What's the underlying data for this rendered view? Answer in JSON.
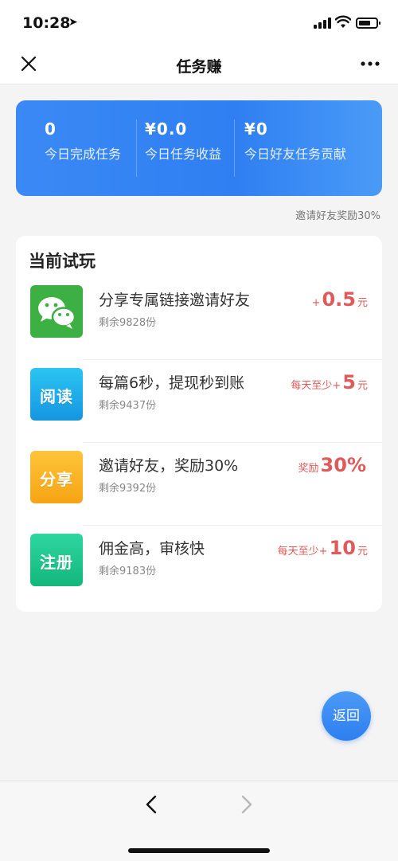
{
  "status": {
    "time": "10:28"
  },
  "nav": {
    "title": "任务赚"
  },
  "stats": [
    {
      "value": "0",
      "label": "今日完成任务"
    },
    {
      "value": "¥0.0",
      "label": "今日任务收益"
    },
    {
      "value": "¥0",
      "label": "今日好友任务贡献"
    }
  ],
  "invite_note": "邀请好友奖励30%",
  "tasks": {
    "heading": "当前试玩",
    "items": [
      {
        "icon": "wechat-icon",
        "icon_text": "",
        "title": "分享专属链接邀请好友",
        "remain": "剩余9828份",
        "reward_prefix": "+",
        "reward_value": "0.5",
        "reward_unit": "元"
      },
      {
        "icon": "read-icon",
        "icon_text": "阅读",
        "title": "每篇6秒，提现秒到账",
        "remain": "剩余9437份",
        "reward_prefix": "每天至少+",
        "reward_value": "5",
        "reward_unit": "元"
      },
      {
        "icon": "share-icon",
        "icon_text": "分享",
        "title": "邀请好友，奖励30%",
        "remain": "剩余9392份",
        "reward_prefix": "奖励",
        "reward_value": "30%",
        "reward_unit": ""
      },
      {
        "icon": "register-icon",
        "icon_text": "注册",
        "title": "佣金高，审核快",
        "remain": "剩余9183份",
        "reward_prefix": "每天至少+",
        "reward_value": "10",
        "reward_unit": "元"
      }
    ]
  },
  "back_label": "返回",
  "colors": {
    "accent": "#2f7ff2",
    "reward": "#e05a5a",
    "wechat": "#3cb043"
  }
}
